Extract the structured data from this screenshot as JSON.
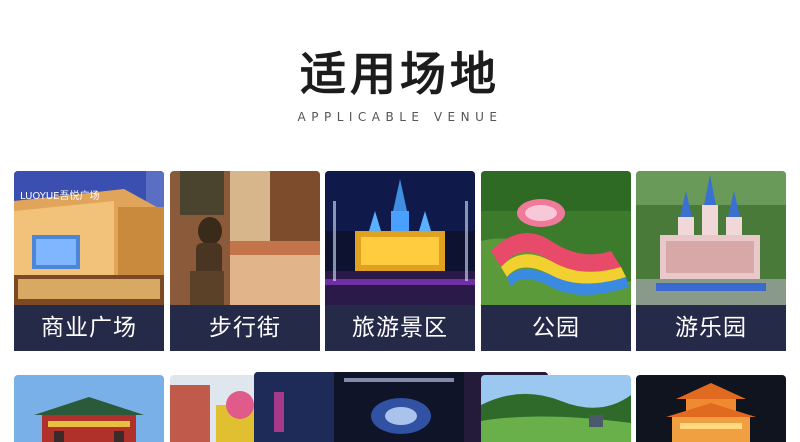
{
  "section": {
    "title": "适用场地",
    "subtitle": "APPLICABLE VENUE"
  },
  "venues": [
    {
      "label": "商业广场",
      "sign_text": "LUOYUE吾悦广场",
      "image": "shopping-mall-photo"
    },
    {
      "label": "步行街",
      "image": "pedestrian-street-photo"
    },
    {
      "label": "旅游景区",
      "image": "scenic-castle-fountain-photo"
    },
    {
      "label": "公园",
      "image": "park-aerial-photo"
    },
    {
      "label": "游乐园",
      "image": "amusement-park-castle-photo"
    }
  ],
  "second_row_images": [
    "temple-gate-photo",
    "amusement-ride-photo",
    "indoor-theme-hall-photo",
    "hillside-park-photo",
    "lit-pagoda-night-photo"
  ],
  "colors": {
    "label_bar": "#252a49",
    "title": "#1c1c1c"
  }
}
